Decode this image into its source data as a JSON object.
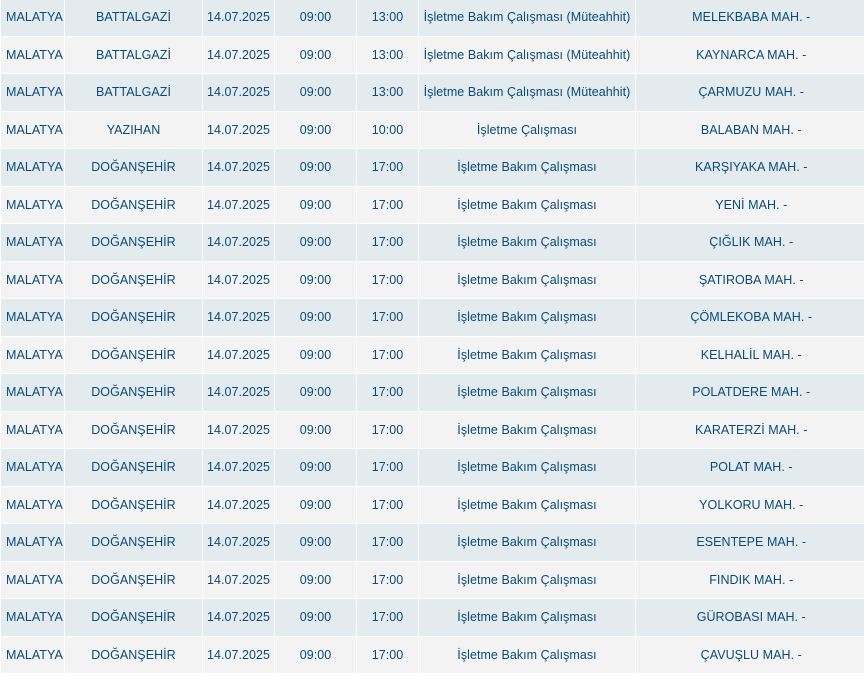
{
  "table": {
    "rows": [
      {
        "il": "MALATYA",
        "ilce": "BATTALGAZİ",
        "tarih": "14.07.2025",
        "baslangic": "09:00",
        "bitis": "13:00",
        "neden": "İşletme Bakım Çalışması (Müteahhit)",
        "mahalle": "MELEKBABA MAH. -"
      },
      {
        "il": "MALATYA",
        "ilce": "BATTALGAZİ",
        "tarih": "14.07.2025",
        "baslangic": "09:00",
        "bitis": "13:00",
        "neden": "İşletme Bakım Çalışması (Müteahhit)",
        "mahalle": "KAYNARCA MAH. -"
      },
      {
        "il": "MALATYA",
        "ilce": "BATTALGAZİ",
        "tarih": "14.07.2025",
        "baslangic": "09:00",
        "bitis": "13:00",
        "neden": "İşletme Bakım Çalışması (Müteahhit)",
        "mahalle": "ÇARMUZU MAH. -"
      },
      {
        "il": "MALATYA",
        "ilce": "YAZIHAN",
        "tarih": "14.07.2025",
        "baslangic": "09:00",
        "bitis": "10:00",
        "neden": "İşletme Çalışması",
        "mahalle": "BALABAN MAH. -"
      },
      {
        "il": "MALATYA",
        "ilce": "DOĞANŞEHİR",
        "tarih": "14.07.2025",
        "baslangic": "09:00",
        "bitis": "17:00",
        "neden": "İşletme Bakım Çalışması",
        "mahalle": "KARŞIYAKA MAH. -"
      },
      {
        "il": "MALATYA",
        "ilce": "DOĞANŞEHİR",
        "tarih": "14.07.2025",
        "baslangic": "09:00",
        "bitis": "17:00",
        "neden": "İşletme Bakım Çalışması",
        "mahalle": "YENİ MAH. -"
      },
      {
        "il": "MALATYA",
        "ilce": "DOĞANŞEHİR",
        "tarih": "14.07.2025",
        "baslangic": "09:00",
        "bitis": "17:00",
        "neden": "İşletme Bakım Çalışması",
        "mahalle": "ÇIĞLIK MAH. -"
      },
      {
        "il": "MALATYA",
        "ilce": "DOĞANŞEHİR",
        "tarih": "14.07.2025",
        "baslangic": "09:00",
        "bitis": "17:00",
        "neden": "İşletme Bakım Çalışması",
        "mahalle": "ŞATIROBA MAH. -"
      },
      {
        "il": "MALATYA",
        "ilce": "DOĞANŞEHİR",
        "tarih": "14.07.2025",
        "baslangic": "09:00",
        "bitis": "17:00",
        "neden": "İşletme Bakım Çalışması",
        "mahalle": "ÇÖMLEKOBA MAH. -"
      },
      {
        "il": "MALATYA",
        "ilce": "DOĞANŞEHİR",
        "tarih": "14.07.2025",
        "baslangic": "09:00",
        "bitis": "17:00",
        "neden": "İşletme Bakım Çalışması",
        "mahalle": "KELHALİL MAH. -"
      },
      {
        "il": "MALATYA",
        "ilce": "DOĞANŞEHİR",
        "tarih": "14.07.2025",
        "baslangic": "09:00",
        "bitis": "17:00",
        "neden": "İşletme Bakım Çalışması",
        "mahalle": "POLATDERE MAH. -"
      },
      {
        "il": "MALATYA",
        "ilce": "DOĞANŞEHİR",
        "tarih": "14.07.2025",
        "baslangic": "09:00",
        "bitis": "17:00",
        "neden": "İşletme Bakım Çalışması",
        "mahalle": "KARATERZİ MAH. -"
      },
      {
        "il": "MALATYA",
        "ilce": "DOĞANŞEHİR",
        "tarih": "14.07.2025",
        "baslangic": "09:00",
        "bitis": "17:00",
        "neden": "İşletme Bakım Çalışması",
        "mahalle": "POLAT MAH. -"
      },
      {
        "il": "MALATYA",
        "ilce": "DOĞANŞEHİR",
        "tarih": "14.07.2025",
        "baslangic": "09:00",
        "bitis": "17:00",
        "neden": "İşletme Bakım Çalışması",
        "mahalle": "YOLKORU MAH. -"
      },
      {
        "il": "MALATYA",
        "ilce": "DOĞANŞEHİR",
        "tarih": "14.07.2025",
        "baslangic": "09:00",
        "bitis": "17:00",
        "neden": "İşletme Bakım Çalışması",
        "mahalle": "ESENTEPE MAH. -"
      },
      {
        "il": "MALATYA",
        "ilce": "DOĞANŞEHİR",
        "tarih": "14.07.2025",
        "baslangic": "09:00",
        "bitis": "17:00",
        "neden": "İşletme Bakım Çalışması",
        "mahalle": "FINDIK MAH. -"
      },
      {
        "il": "MALATYA",
        "ilce": "DOĞANŞEHİR",
        "tarih": "14.07.2025",
        "baslangic": "09:00",
        "bitis": "17:00",
        "neden": "İşletme Bakım Çalışması",
        "mahalle": "GÜROBASI MAH. -"
      },
      {
        "il": "MALATYA",
        "ilce": "DOĞANŞEHİR",
        "tarih": "14.07.2025",
        "baslangic": "09:00",
        "bitis": "17:00",
        "neden": "İşletme Bakım Çalışması",
        "mahalle": "ÇAVUŞLU MAH. -"
      }
    ]
  },
  "colors": {
    "text": "#0b4a7a",
    "row_odd": "#e4ebee",
    "row_even": "#f3f3f3",
    "cell_border": "#ffffff"
  }
}
